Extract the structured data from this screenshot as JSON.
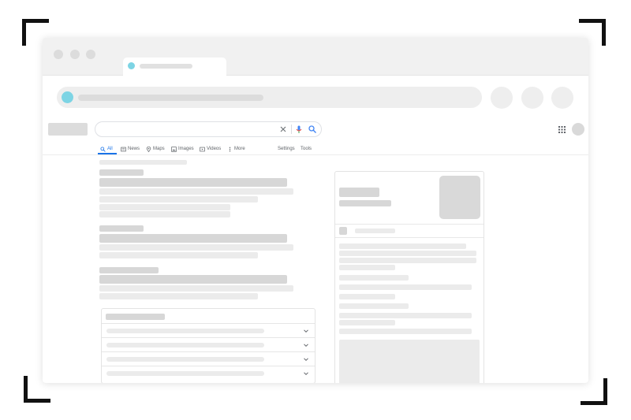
{
  "nav": {
    "all": "All",
    "news": "News",
    "maps": "Maps",
    "images": "Images",
    "videos": "Videos",
    "more": "More",
    "settings": "Settings",
    "tools": "Tools"
  },
  "icons": {
    "clear": "close-icon",
    "voice": "microphone-icon",
    "search": "search-icon",
    "apps": "apps-grid-icon",
    "expand": "chevron-down-icon"
  },
  "colors": {
    "accent": "#1a73e8",
    "favicon": "#7dd4e4",
    "mic_red": "#ea4335"
  },
  "people_also_ask": {
    "question_count": 4
  }
}
